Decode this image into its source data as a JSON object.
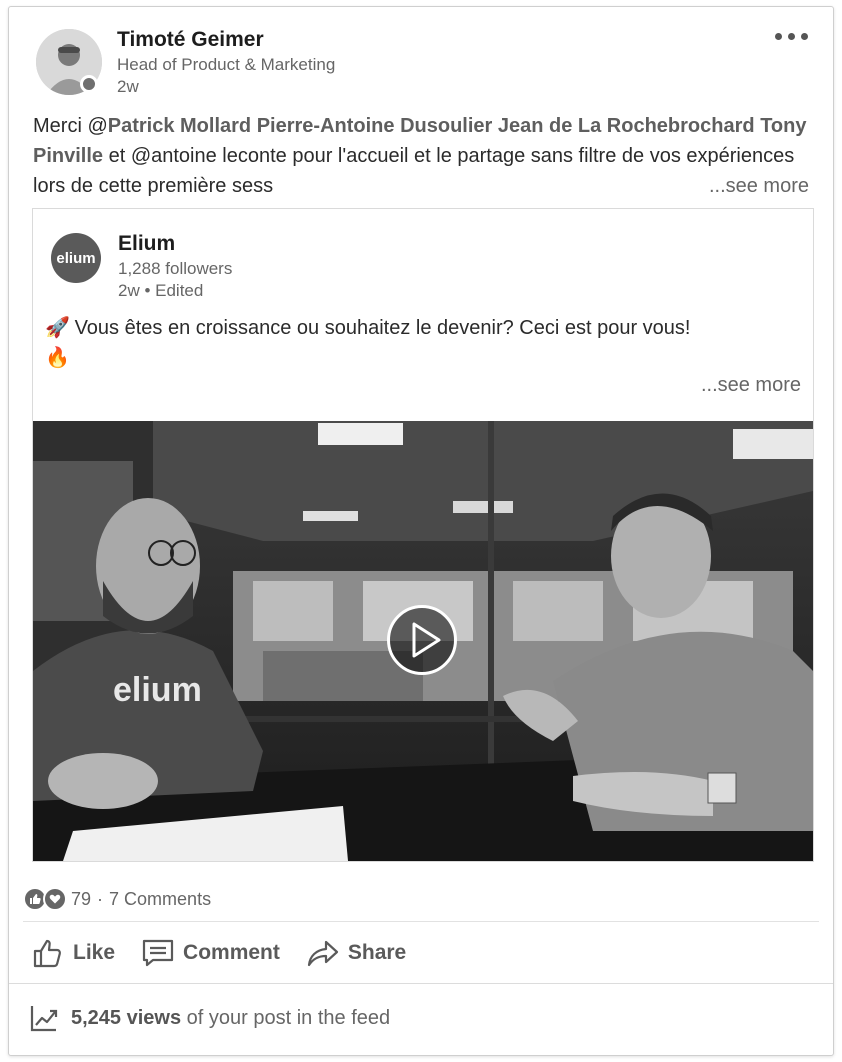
{
  "author": {
    "name": "Timoté Geimer",
    "title": "Head of Product & Marketing",
    "time": "2w"
  },
  "post": {
    "text_prefix": "Merci @",
    "mentions": [
      "Patrick Mollard",
      "Pierre-Antoine Dusoulier",
      "Jean de La Rochebrochard",
      "Tony Pinville"
    ],
    "text_suffix": " et @antoine leconte pour l'accueil et le partage sans filtre de vos expériences lors de cette première sess",
    "see_more": "...see more"
  },
  "shared_post": {
    "org_logo_text": "elium",
    "org_name": "Elium",
    "followers": "1,288 followers",
    "time": "2w • Edited",
    "text": "Vous êtes en croissance ou souhaitez le devenir? Ceci est pour vous!",
    "emoji_start": "🚀",
    "emoji_end": "🔥",
    "see_more": "...see more",
    "video_shirt_text": "elium"
  },
  "social": {
    "reactions_count": "79",
    "separator": "·",
    "comments": "7 Comments"
  },
  "actions": {
    "like": "Like",
    "comment": "Comment",
    "share": "Share"
  },
  "analytics": {
    "views_count": "5,245 views",
    "views_suffix": " of your post in the feed"
  },
  "icons": [
    "more-icon",
    "like-icon",
    "comment-icon",
    "share-icon",
    "analytics-icon",
    "play-icon",
    "thumb-reaction-icon",
    "heart-reaction-icon"
  ]
}
